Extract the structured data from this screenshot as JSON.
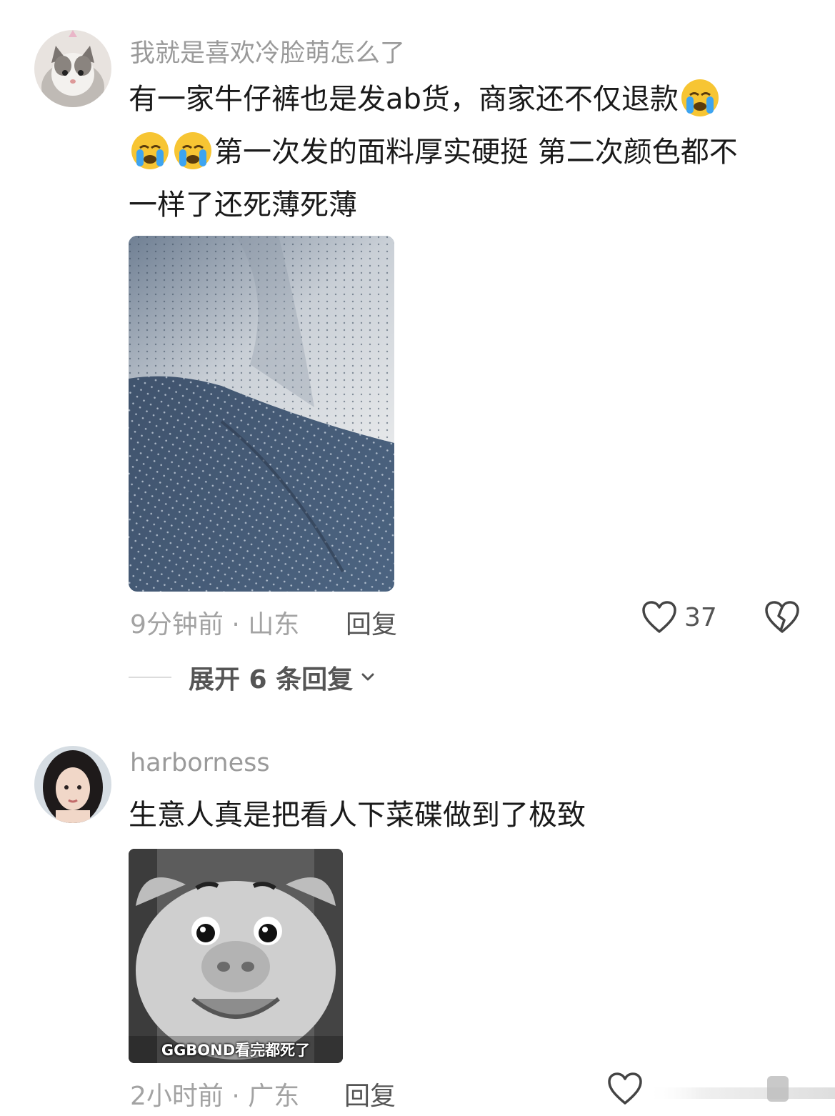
{
  "comments": [
    {
      "username": "我就是喜欢冷脸萌怎么了",
      "avatar_icon": "cat-avatar-icon",
      "text_line1": "有一家牛仔裤也是发ab货，商家还不仅退款",
      "text_line2": "第一次发的面料厚实硬挺 第二次颜色都不",
      "text_line3": "一样了还死薄死薄",
      "emoji_icon": "loudly-crying-face-icon",
      "time_location": "9分钟前 · 山东",
      "reply_label": "回复",
      "like_count": "37",
      "expand_label": "展开 6 条回复"
    },
    {
      "username": "harborness",
      "avatar_icon": "woman-avatar-icon",
      "text": "生意人真是把看人下菜碟做到了极致",
      "sticker_caption": "GGBOND看完都死了",
      "time_location": "2小时前 · 广东",
      "reply_label": "回复"
    }
  ],
  "colors": {
    "username": "#9a9a9a",
    "body_text": "#1a1a1a",
    "meta": "#a3a3a3",
    "action": "#555555"
  }
}
